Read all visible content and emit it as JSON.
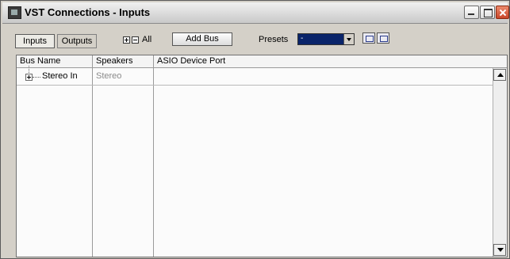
{
  "window": {
    "title": "VST Connections - Inputs",
    "icon": "vst-app-icon"
  },
  "toolbar": {
    "tabs": [
      {
        "label": "Inputs",
        "active": true
      },
      {
        "label": "Outputs",
        "active": false
      }
    ],
    "expand_all_label": "All",
    "add_bus_label": "Add Bus",
    "presets_label": "Presets",
    "presets_value": "-"
  },
  "table": {
    "columns": [
      "Bus Name",
      "Speakers",
      "ASIO Device Port"
    ],
    "rows": [
      {
        "bus_name": "Stereo In",
        "speakers": "Stereo",
        "asio_device_port": ""
      }
    ]
  },
  "colors": {
    "titlebar": "#d9d9d9",
    "close_button": "#d5583a",
    "presets_select_bg": "#0a246a",
    "speakers_text": "#8a8a8a"
  }
}
